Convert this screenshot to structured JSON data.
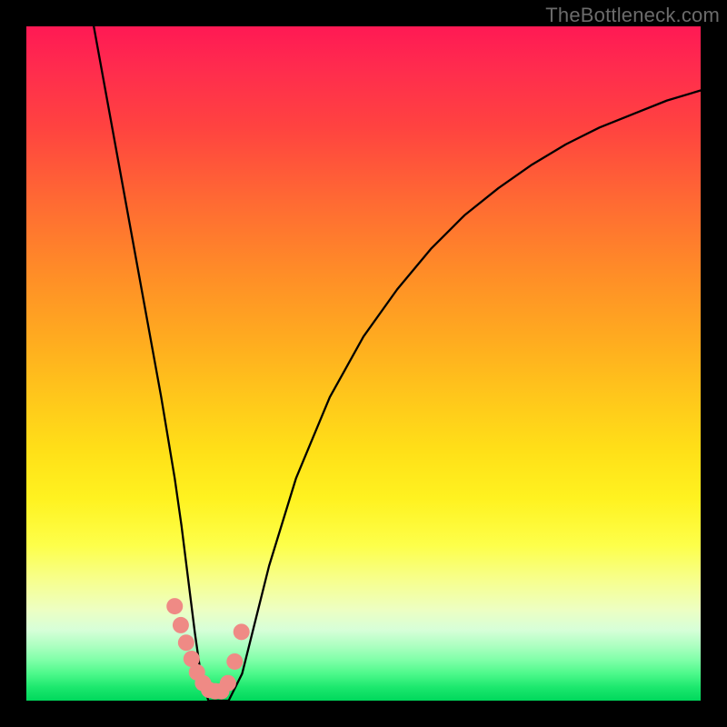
{
  "watermark": "TheBottleneck.com",
  "chart_data": {
    "type": "line",
    "title": "",
    "xlabel": "",
    "ylabel": "",
    "xlim": [
      0,
      100
    ],
    "ylim": [
      0,
      100
    ],
    "grid": false,
    "legend": false,
    "series": [
      {
        "name": "curve",
        "color": "#000000",
        "x": [
          10,
          12,
          14,
          16,
          18,
          20,
          22,
          23,
          24,
          25,
          26,
          27,
          28,
          30,
          32,
          34,
          36,
          40,
          45,
          50,
          55,
          60,
          65,
          70,
          75,
          80,
          85,
          90,
          95,
          100
        ],
        "values": [
          100,
          89,
          78,
          67,
          56,
          45,
          33,
          26,
          18,
          10,
          3,
          0,
          0,
          0,
          4,
          12,
          20,
          33,
          45,
          54,
          61,
          67,
          72,
          76,
          79.5,
          82.5,
          85,
          87,
          89,
          90.5
        ]
      },
      {
        "name": "bottleneck-markers",
        "color": "#ef8a85",
        "style": "dots",
        "x": [
          22.0,
          22.9,
          23.7,
          24.5,
          25.3,
          26.2,
          27.1,
          28.0,
          28.9,
          29.9,
          30.9,
          31.9
        ],
        "values": [
          14.0,
          11.2,
          8.6,
          6.2,
          4.2,
          2.6,
          1.6,
          1.4,
          1.4,
          2.6,
          5.8,
          10.2
        ]
      }
    ]
  }
}
